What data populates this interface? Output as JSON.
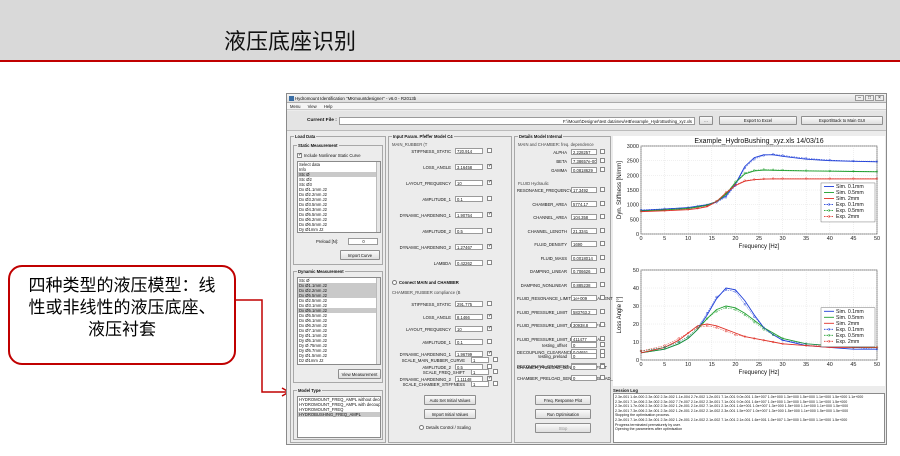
{
  "slide": {
    "title": "液压底座识别",
    "callout_lines": [
      "四种类型的液压模型：线",
      "性或非线性的液压底座、",
      "液压衬套"
    ]
  },
  "window": {
    "title": "Hydromount Identification \"MKmountdesigner\" - v6.0 - R2013b",
    "menu": [
      "Menu",
      "View",
      "Help"
    ],
    "current_file_label": "Current File :",
    "current_file_path": "F:\\\\Mount\\Designer\\test data\\new\\HB\\example_HydroBushing_xyz.xls",
    "browse_label": "...",
    "export_excel": "Export to Excel",
    "export_gui": "Export/Back to Main GUI"
  },
  "load_data": {
    "panel_title": "Load Data",
    "static_title": "Static Measurement",
    "include_nonlinear": "Include Nonlinear Static Curve",
    "static_list": [
      "Select data",
      "Info",
      "Stc Ø",
      "Stc Ø2",
      "Stc Ø3",
      "Dx Ø1.1mm J2",
      "Dx Ø2.2mm J2",
      "Dx Ø3.2mm J2",
      "Dx Ø3.5mm J2",
      "Dx Ø4.3mm J2",
      "Dx Ø5.5mm J2",
      "Dx Ø6.2mm J2",
      "Dx Ø6.5mm J2",
      "Dy Ø1mm J2",
      "Dy Ø5mm J2"
    ],
    "preload_label": "Preload [N]:",
    "preload_value": "0",
    "import_curve": "Import Curve",
    "dynamic_title": "Dynamic Measurement",
    "dynamic_list": [
      "Stc Ø",
      "Dx Ø1.1mm J2",
      "Dx Ø2.2mm J2",
      "Dx Ø5.5mm J2",
      "Dx Ø2.5mm J2",
      "Dx Ø3.1mm J2",
      "Dx Ø5.1mm J2",
      "Dx Ø5.5mm J2",
      "Dx Ø6.1mm J2",
      "Dx Ø6.2mm J2",
      "Dx Ø7.1mm J2",
      "Dy Ø1.1mm J2",
      "Dy Ø5.1mm J2",
      "Dy Ø.75mm J2",
      "Dy Ø5.7mm J2",
      "Dy Ø1.5mm J2",
      "Dz Ø1mm J2",
      "Dz Ø2mm J2"
    ],
    "view_measurement": "View Measurement",
    "model_type_title": "Model Type",
    "model_types": [
      "HYDROMOUNT_FREQ_AMPL without decouple",
      "HYDROMOUNT_FREQ_AMPL with decoupler",
      "HYDROMOUNT_FREQ",
      "HYDROBUSHING_FREQ_AMPL"
    ]
  },
  "input_params": {
    "panel_title": "Input Param. Pfeffer Model C4",
    "main_rubber_title": "MAIN_RUBBER (T",
    "main_rows": [
      {
        "label": "STIFFNESS_STATIC",
        "value": "720.914",
        "checked": false
      },
      {
        "label": "LOSS_ANGLE",
        "value": "3.16458",
        "checked": true
      },
      {
        "label": "LAYOUT_FREQUENCY",
        "value": "10",
        "checked": true
      },
      {
        "label": "AMPLITUDE_1",
        "value": "0.1",
        "checked": false
      },
      {
        "label": "DYNAMIC_HARDENING_1",
        "value": "1.90754",
        "checked": true
      },
      {
        "label": "AMPLITUDE_2",
        "value": "0.5",
        "checked": false
      },
      {
        "label": "DYNAMIC_HARDENING_2",
        "value": "1.27467",
        "checked": true
      },
      {
        "label": "LAMBDA",
        "value": "0.42262",
        "checked": false
      }
    ],
    "connect_label": "Connect MAIN and CHAMBER",
    "chamber_title": "CHAMBER_RUBBER compliance (B",
    "chamber_rows": [
      {
        "label": "STIFFNESS_STATIC",
        "value": "291.775",
        "checked": false
      },
      {
        "label": "LOSS_ANGLE",
        "value": "8.1466",
        "checked": true
      },
      {
        "label": "LAYOUT_FREQUENCY",
        "value": "10",
        "checked": true
      },
      {
        "label": "AMPLITUDE_1",
        "value": "0.1",
        "checked": false
      },
      {
        "label": "DYNAMIC_HARDENING_1",
        "value": "1.96799",
        "checked": true
      },
      {
        "label": "AMPLITUDE_2",
        "value": "0.5",
        "checked": false
      },
      {
        "label": "DYNAMIC_HARDENING_2",
        "value": "1.11148",
        "checked": true
      }
    ],
    "scale_rows": [
      {
        "label": "SCALE_MAIN_RUBBER_CURVE",
        "value": "1"
      },
      {
        "label": "SCALE_FREQ_SHIFT",
        "value": "1"
      },
      {
        "label": "SCALE_CHAMBER_STIFFNESS",
        "value": "1"
      }
    ],
    "auto_set": "Auto Set Initial Values",
    "import_values": "Import Initial Values",
    "details_label": "Details Control / Scaling"
  },
  "details_model": {
    "panel_title": "Details Model Internal",
    "subtitle": "MAIN and CHAMBER: freq. dependence",
    "top_rows": [
      {
        "label": "ALPHA",
        "value": "2.228257"
      },
      {
        "label": "BETA",
        "value": "7.38657e-006"
      },
      {
        "label": "GAMMA",
        "value": "0.0818629"
      }
    ],
    "fluid_title": "FLUID Hydraulic",
    "fluid_rows": [
      {
        "label": "RESONANCE_FREQUENCY",
        "value": "17.3492"
      },
      {
        "label": "CHAMBER_AREA",
        "value": "5774.17"
      },
      {
        "label": "CHANNEL_AREA",
        "value": "104.358"
      },
      {
        "label": "CHANNEL_LENGTH",
        "value": "21.3341"
      },
      {
        "label": "FLUID_DENSITY",
        "value": "1690"
      },
      {
        "label": "FLUID_MASS",
        "value": "0.0018014"
      },
      {
        "label": "DAMPING_LINEAR",
        "value": "0.706626"
      },
      {
        "label": "DAMPING_NONLINEAR",
        "value": "0.885238"
      },
      {
        "label": "FLUID_RESONANCE_LIMIT_SIGNAL_GRADIENT",
        "value": "1e+009"
      },
      {
        "label": "FLUID_PRESSURE_LIMIT",
        "value": "583763.2"
      },
      {
        "label": "FLUID_PRESSURE_LIMIT_BYPASS_ORIFICE",
        "value": "30938.8"
      },
      {
        "label": "FLUID_PRESSURE_LIMIT_BYPASS_AREA",
        "value": "411477"
      },
      {
        "label": "DECOUPLING_CLEARANCE",
        "value": "0.04651"
      },
      {
        "label": "DECOUPLING_GRADIENT",
        "value": "0.103985"
      }
    ],
    "bottom_rows": [
      {
        "label": "testing_offset",
        "value": "0"
      },
      {
        "label": "testing_preload",
        "value": "0"
      },
      {
        "label": "CHAMBER_PRELOAD_SENSITIVITY_OFFSET",
        "value": "0"
      },
      {
        "label": "CHAMBER_PRELOAD_SENSITIVITY_PRELOAD_GRADIENT",
        "value": "0"
      }
    ],
    "freq_plot": "Freq. Response Plot",
    "run_opt": "Run Optimisation",
    "stop": "Stop"
  },
  "plots": {
    "top_title": "Example_HydroBushing_xyz.xls  14/03/16",
    "top_ylabel": "Dyn. Stiffness [N/mm]",
    "xlabel": "Frequency [Hz]",
    "bottom_ylabel": "Loss Angle [°]",
    "legend": [
      "Sim. 0.1mm",
      "Sim. 0.5mm",
      "Sim. 2mm",
      "Exp. 0.1mm",
      "Exp. 0.5mm",
      "Exp. 2mm"
    ],
    "colors": {
      "blue": "#1f3fd8",
      "green": "#1f9f2f",
      "red": "#e0332a"
    }
  },
  "chart_data": [
    {
      "type": "line",
      "title": "Example_HydroBushing_xyz.xls  14/03/16",
      "xlabel": "Frequency [Hz]",
      "ylabel": "Dyn. Stiffness [N/mm]",
      "xlim": [
        0,
        50
      ],
      "ylim": [
        0,
        3000
      ],
      "x_ticks": [
        0,
        5,
        10,
        15,
        20,
        25,
        30,
        35,
        40,
        45,
        50
      ],
      "y_ticks": [
        0,
        500,
        1000,
        1500,
        2000,
        2500,
        3000
      ],
      "grid": true,
      "legend_position": "right",
      "x": [
        0,
        5,
        10,
        12,
        14,
        16,
        18,
        20,
        22,
        24,
        26,
        28,
        30,
        35,
        40,
        45,
        50
      ],
      "series": [
        {
          "name": "Sim. 0.1mm",
          "color": "#1f3fd8",
          "values": [
            800,
            850,
            900,
            950,
            1000,
            1100,
            1300,
            1700,
            2300,
            2600,
            2700,
            2700,
            2650,
            2550,
            2500,
            2480,
            2460
          ]
        },
        {
          "name": "Sim. 0.5mm",
          "color": "#1f9f2f",
          "values": [
            780,
            820,
            870,
            920,
            980,
            1100,
            1350,
            1750,
            2050,
            2150,
            2180,
            2170,
            2160,
            2150,
            2140,
            2130,
            2120
          ]
        },
        {
          "name": "Sim. 2mm",
          "color": "#e0332a",
          "values": [
            760,
            790,
            830,
            870,
            930,
            1100,
            1400,
            1650,
            1800,
            1850,
            1870,
            1880,
            1880,
            1880,
            1880,
            1880,
            1880
          ]
        },
        {
          "name": "Exp. 0.1mm",
          "color": "#1f3fd8",
          "values": [
            820,
            860,
            900,
            940,
            990,
            1080,
            1250,
            1650,
            2250,
            2550,
            2680,
            2720,
            2680,
            2580,
            2520,
            2490,
            2470
          ]
        },
        {
          "name": "Exp. 0.5mm",
          "color": "#1f9f2f",
          "values": [
            790,
            830,
            880,
            930,
            990,
            1120,
            1380,
            1780,
            2080,
            2170,
            2200,
            2190,
            2180,
            2160,
            2150,
            2140,
            2130
          ]
        },
        {
          "name": "Exp. 2mm",
          "color": "#e0332a",
          "values": [
            770,
            800,
            840,
            880,
            950,
            1120,
            1420,
            1680,
            1820,
            1860,
            1880,
            1890,
            1890,
            1890,
            1890,
            1890,
            1890
          ]
        }
      ]
    },
    {
      "type": "line",
      "title": "",
      "xlabel": "Frequency [Hz]",
      "ylabel": "Loss Angle [°]",
      "xlim": [
        0,
        50
      ],
      "ylim": [
        0,
        50
      ],
      "x_ticks": [
        0,
        5,
        10,
        15,
        20,
        25,
        30,
        35,
        40,
        45,
        50
      ],
      "y_ticks": [
        0,
        10,
        20,
        30,
        40,
        50
      ],
      "grid": true,
      "legend_position": "right",
      "x": [
        0,
        5,
        8,
        10,
        12,
        14,
        16,
        18,
        20,
        22,
        24,
        26,
        28,
        30,
        35,
        40,
        45,
        50
      ],
      "series": [
        {
          "name": "Sim. 0.1mm",
          "color": "#1f3fd8",
          "values": [
            4,
            6,
            9,
            12,
            17,
            25,
            34,
            40,
            39,
            33,
            25,
            18,
            14,
            11,
            8,
            7,
            6,
            6
          ]
        },
        {
          "name": "Sim. 0.5mm",
          "color": "#1f9f2f",
          "values": [
            4,
            6,
            9,
            12,
            17,
            23,
            28,
            30,
            29,
            26,
            22,
            18,
            15,
            12,
            9,
            8,
            7,
            7
          ]
        },
        {
          "name": "Sim. 2mm",
          "color": "#e0332a",
          "values": [
            4,
            7,
            11,
            15,
            19,
            20,
            19,
            17,
            15,
            13,
            12,
            11,
            10,
            9,
            8,
            7,
            7,
            7
          ]
        },
        {
          "name": "Exp. 0.1mm",
          "color": "#1f3fd8",
          "values": [
            5,
            7,
            10,
            13,
            18,
            26,
            35,
            39,
            38,
            31,
            24,
            18,
            14,
            11,
            9,
            8,
            7,
            6
          ]
        },
        {
          "name": "Exp. 0.5mm",
          "color": "#1f9f2f",
          "values": [
            5,
            7,
            10,
            13,
            18,
            23,
            27,
            29,
            28,
            25,
            21,
            17,
            14,
            12,
            9,
            8,
            7,
            7
          ]
        },
        {
          "name": "Exp. 2mm",
          "color": "#e0332a",
          "values": [
            5,
            8,
            12,
            15,
            18,
            19,
            18,
            16,
            14,
            13,
            12,
            11,
            10,
            9,
            8,
            8,
            7,
            7
          ]
        }
      ]
    }
  ],
  "session_log": {
    "title": "Session Log",
    "lines": [
      "2.3e-001 1.4e-000 2.3e-002 2.3e-002 1.1e-004 2.7e-002 1.2e-001 7.1e-001 9.0e-001 1.5e+007 1.0e+000 1.3e+000 1.5e+000 1.1e+000 1.5e+000 1.1e+000",
      "2.3e-001 7.1e-006 2.3e-002 2.3e-002 7.7e-007 2.1e-002 2.3e-001 7.1e-001 9.0e-001 1.6e+007 1.0e+000 1.3e+000 1.5e+000 1.1e+000 1.5e+000",
      "2.3e-001 1.7e-006 2.3e-002 2.3e-002 1.2e-001 2.1e-002 7.1e-001 2.1e-001 1.6e+001 1.0e+007 1.3e+000 1.5e+000 1.1e+000 1.1e+000 1.5e+000",
      "2.3e-001 7.3e-006 2.3e-001 2.3e-002 1.2e-001 2.1e-002 2.1e-002 2.3e-001 1.5e+007 1.0e+007 1.3e+000 1.5e+000 1.1e+000 1.5e+000 1.5e+000",
      "Stopping the optimisation process.",
      "2.3e-001 7.1e-006 2.3e-001 2.3e-002 1.2e-001 2.1e-002 2.1e-002 7.1e-001 2.1e-001 1.6e+001 1.0e+007 1.3e+000 1.5e+000 1.1e+000 1.5e+000",
      "Progress terminated prematurely by user.",
      "Opening the parameters after optimisation"
    ]
  }
}
